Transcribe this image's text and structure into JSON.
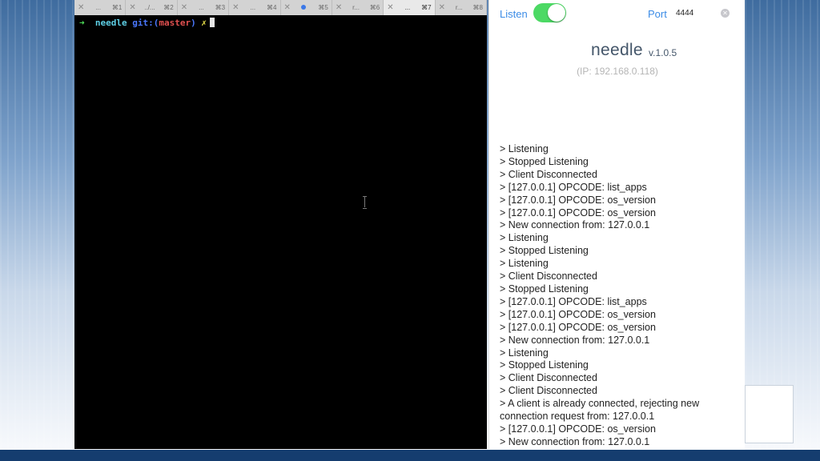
{
  "terminal": {
    "tabs": [
      {
        "label": "...",
        "shortcut": "⌘1",
        "active": false
      },
      {
        "label": "../...",
        "shortcut": "⌘2",
        "active": false
      },
      {
        "label": "...",
        "shortcut": "⌘3",
        "active": false
      },
      {
        "label": "...",
        "shortcut": "⌘4",
        "active": false
      },
      {
        "label": "",
        "shortcut": "⌘5",
        "active": false
      },
      {
        "label": "r...",
        "shortcut": "⌘6",
        "active": false
      },
      {
        "label": "...",
        "shortcut": "⌘7",
        "active": true
      },
      {
        "label": "r...",
        "shortcut": "⌘8",
        "active": false
      }
    ],
    "prompt": {
      "arrow": "➜",
      "dir": "needle",
      "git": "git:",
      "open_paren": "(",
      "branch": "master",
      "close_paren": ")",
      "dirty": "✗"
    },
    "close_glyph": "✕"
  },
  "app": {
    "listen_label": "Listen",
    "listen_on": true,
    "port_label": "Port",
    "port_value": "4444",
    "name": "needle",
    "version": "v.1.0.5",
    "ip": "(IP: 192.168.0.118)",
    "log": [
      "> Listening",
      "> Stopped Listening",
      "> Client Disconnected",
      "> [127.0.0.1] OPCODE: list_apps",
      "> [127.0.0.1] OPCODE: os_version",
      "> [127.0.0.1] OPCODE: os_version",
      "> New connection from: 127.0.0.1",
      "> Listening",
      "> Stopped Listening",
      "> Listening",
      "> Client Disconnected",
      "> Stopped Listening",
      "> [127.0.0.1] OPCODE: list_apps",
      "> [127.0.0.1] OPCODE: os_version",
      "> [127.0.0.1] OPCODE: os_version",
      "> New connection from: 127.0.0.1",
      "> Listening",
      "> Stopped Listening",
      "> Client Disconnected",
      "> Client Disconnected",
      "> A client is already connected, rejecting new connection request from: 127.0.0.1",
      "> [127.0.0.1] OPCODE: os_version",
      "> New connection from: 127.0.0.1"
    ]
  },
  "colors": {
    "accent": "#3c8ce6",
    "toggle_on": "#4cd964",
    "slide_bar": "#153d6f"
  }
}
